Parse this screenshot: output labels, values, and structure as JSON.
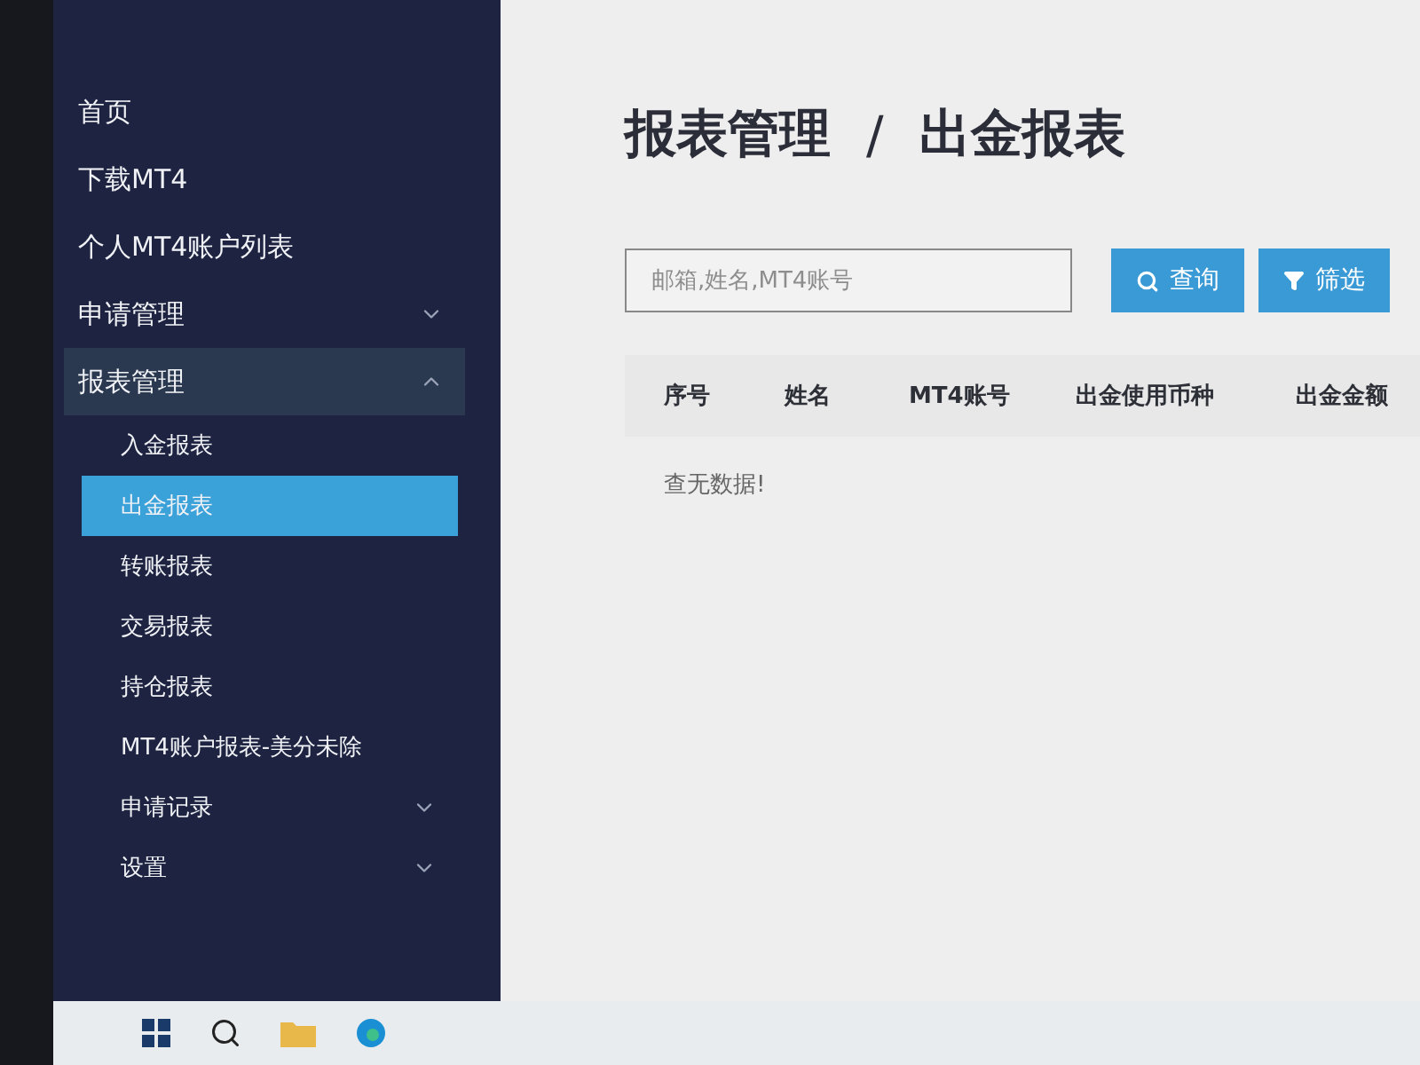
{
  "sidebar": {
    "items": [
      {
        "kind": "link",
        "label": "首页",
        "selected": false
      },
      {
        "kind": "link",
        "label": "下载MT4",
        "selected": false
      },
      {
        "kind": "link",
        "label": "个人MT4账户列表",
        "selected": false
      },
      {
        "kind": "group",
        "label": "申请管理",
        "expanded": false
      },
      {
        "kind": "group",
        "label": "报表管理",
        "expanded": true,
        "children": [
          {
            "kind": "link",
            "label": "入金报表",
            "selected": false
          },
          {
            "kind": "link",
            "label": "出金报表",
            "selected": true
          },
          {
            "kind": "link",
            "label": "转账报表",
            "selected": false
          },
          {
            "kind": "link",
            "label": "交易报表",
            "selected": false
          },
          {
            "kind": "link",
            "label": "持仓报表",
            "selected": false
          },
          {
            "kind": "link",
            "label": "MT4账户报表-美分未除",
            "selected": false
          },
          {
            "kind": "group",
            "label": "申请记录",
            "expanded": false
          },
          {
            "kind": "group",
            "label": "设置",
            "expanded": false
          }
        ]
      }
    ]
  },
  "breadcrumb": {
    "parent": "报表管理",
    "separator": "/",
    "current": "出金报表"
  },
  "search": {
    "placeholder": "邮箱,姓名,MT4账号"
  },
  "buttons": [
    {
      "kind": "search",
      "label": "查询"
    },
    {
      "kind": "filter",
      "label": "筛选"
    }
  ],
  "table": {
    "columns": [
      "序号",
      "姓名",
      "MT4账号",
      "出金使用币种",
      "出金金额"
    ],
    "empty_message": "查无数据!"
  }
}
